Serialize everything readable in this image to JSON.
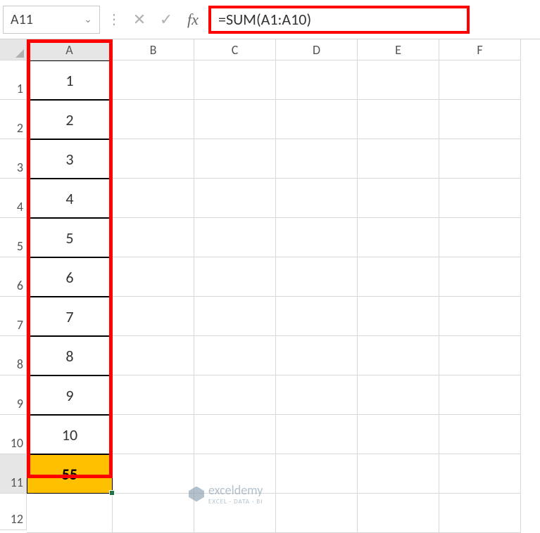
{
  "name_box": "A11",
  "fx_label": "fx",
  "formula": "=SUM(A1:A10)",
  "columns": [
    "A",
    "B",
    "C",
    "D",
    "E",
    "F"
  ],
  "rows": [
    {
      "num": "1",
      "a": "1"
    },
    {
      "num": "2",
      "a": "2"
    },
    {
      "num": "3",
      "a": "3"
    },
    {
      "num": "4",
      "a": "4"
    },
    {
      "num": "5",
      "a": "5"
    },
    {
      "num": "6",
      "a": "6"
    },
    {
      "num": "7",
      "a": "7"
    },
    {
      "num": "8",
      "a": "8"
    },
    {
      "num": "9",
      "a": "9"
    },
    {
      "num": "10",
      "a": "10"
    }
  ],
  "sum_row": {
    "num": "11",
    "a": "55"
  },
  "extra_row": {
    "num": "12"
  },
  "watermark": {
    "name": "exceldemy",
    "sub": "EXCEL · DATA · BI"
  }
}
